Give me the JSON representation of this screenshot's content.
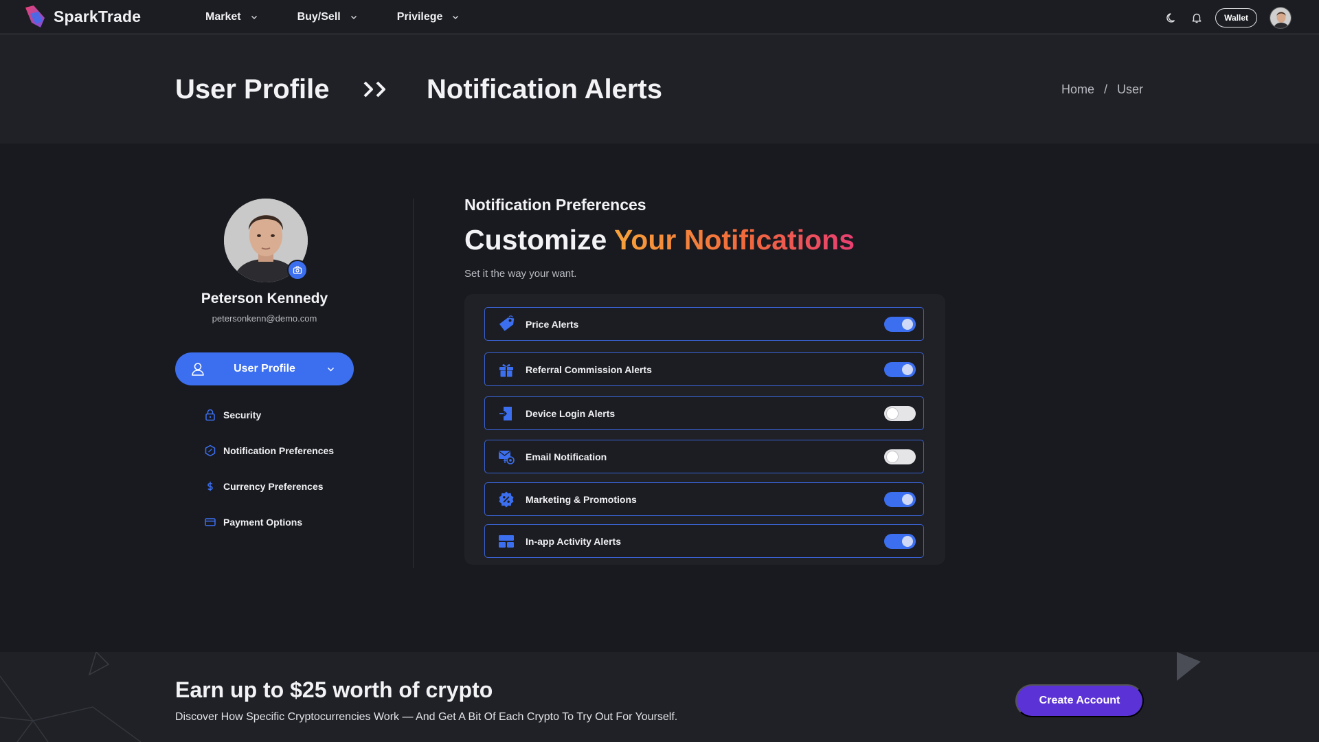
{
  "app": {
    "brand": "SparkTrade",
    "colors": {
      "accent": "#3c6ff0",
      "cta": "#5b32d6",
      "gradient_start": "#f7a23b",
      "gradient_end": "#e83f72"
    }
  },
  "nav": {
    "menu": [
      {
        "label": "Market",
        "icon": "chevron-down-icon"
      },
      {
        "label": "Buy/Sell",
        "icon": "chevron-down-icon"
      },
      {
        "label": "Privilege",
        "icon": "chevron-down-icon"
      }
    ],
    "icons": [
      "moon-icon",
      "bell-icon"
    ],
    "wallet_label": "Wallet"
  },
  "hero": {
    "title": "User Profile",
    "arrow": ">>",
    "subtitle": "Notification Alerts",
    "breadcrumb": {
      "home": "Home",
      "separator": "/",
      "current": "User"
    }
  },
  "profile": {
    "name": "Peterson Kennedy",
    "email": "petersonkenn@demo.com",
    "button_label": "User Profile",
    "subnav": [
      {
        "label": "Security",
        "icon": "lock-icon"
      },
      {
        "label": "Notification Preferences",
        "icon": "badge-icon"
      },
      {
        "label": "Currency Preferences",
        "icon": "dollar-icon"
      },
      {
        "label": "Payment Options",
        "icon": "card-icon"
      }
    ]
  },
  "main": {
    "section_label": "Notification Preferences",
    "title_plain": "Customize",
    "title_highlight": "Your Notifications",
    "subtitle": "Set it the way your want.",
    "alerts": [
      {
        "label": "Price Alerts",
        "icon": "price-tag-icon",
        "enabled": true
      },
      {
        "label": "Referral Commission Alerts",
        "icon": "gift-icon",
        "enabled": true
      },
      {
        "label": "Device Login Alerts",
        "icon": "login-icon",
        "enabled": false
      },
      {
        "label": "Email Notification",
        "icon": "email-icon",
        "enabled": false
      },
      {
        "label": "Marketing & Promotions",
        "icon": "discount-icon",
        "enabled": true
      },
      {
        "label": "In-app Activity Alerts",
        "icon": "dashboard-icon",
        "enabled": true
      }
    ]
  },
  "footer": {
    "title": "Earn up to $25 worth of crypto",
    "subtitle": "Discover How Specific Cryptocurrencies Work — And Get A Bit Of Each Crypto To Try Out For Yourself.",
    "cta_label": "Create Account"
  }
}
